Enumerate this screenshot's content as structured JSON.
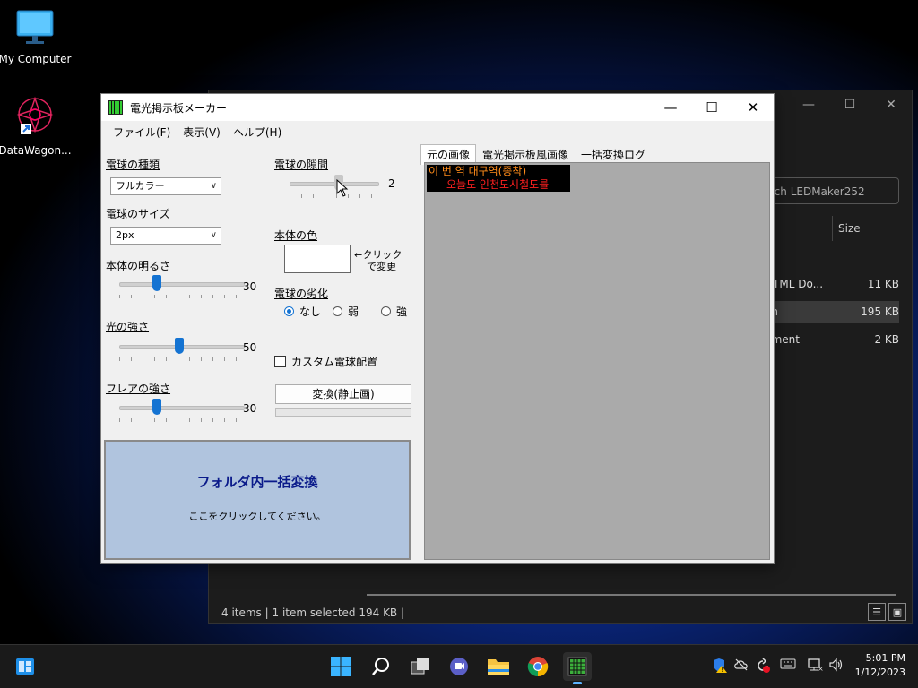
{
  "desktop": {
    "icons": [
      {
        "label": "My Computer",
        "icon": "monitor-icon"
      },
      {
        "label": "DataWagon...",
        "icon": "datawagon-shortcut-icon"
      }
    ]
  },
  "explorer": {
    "search_placeholder": "rch LEDMaker252",
    "col_size": "Size",
    "rows": [
      {
        "name": "HTML Do...",
        "size": "11 KB"
      },
      {
        "name": "on",
        "size": "195 KB",
        "selected": true
      },
      {
        "name": "ument",
        "size": "2 KB"
      }
    ],
    "status": {
      "items": "4 items",
      "selected": "1 item selected  194 KB"
    }
  },
  "app": {
    "title": "電光掲示板メーカー",
    "menu": [
      "ファイル(F)",
      "表示(V)",
      "ヘルプ(H)"
    ],
    "bulb_type": {
      "label": "電球の種類",
      "value": "フルカラー"
    },
    "bulb_size": {
      "label": "電球のサイズ",
      "value": "2px"
    },
    "body_brightness": {
      "label": "本体の明るさ",
      "value": "30"
    },
    "light_strength": {
      "label": "光の強さ",
      "value": "50"
    },
    "flare_strength": {
      "label": "フレアの強さ",
      "value": "30"
    },
    "bulb_gap": {
      "label": "電球の隙間",
      "value": "2"
    },
    "body_color": {
      "label": "本体の色",
      "hint1": "←クリック",
      "hint2": "で変更",
      "color": "#ffffff"
    },
    "bulb_degrade": {
      "label": "電球の劣化",
      "options": [
        "なし",
        "弱",
        "強"
      ],
      "selected": "なし"
    },
    "custom_layout": {
      "label": "カスタム電球配置",
      "checked": false
    },
    "convert_button": "変換(静止画)",
    "batch": {
      "title": "フォルダ内一括変換",
      "subtitle": "ここをクリックしてください。"
    },
    "tabs": [
      "元の画像",
      "電光掲示板風画像",
      "一括変換ログ"
    ],
    "active_tab": "元の画像",
    "preview": {
      "line1": "이 번 역 대구역(종착)",
      "line2": "오늘도 인천도시철도를"
    }
  },
  "taskbar": {
    "clock_time": "5:01 PM",
    "clock_date": "1/12/2023",
    "apps": [
      "windows-start-icon",
      "search-icon",
      "task-view-icon",
      "chat-icon",
      "file-explorer-icon",
      "chrome-icon",
      "led-maker-icon"
    ]
  },
  "colors": {
    "accent": "#1473d2",
    "batch_bg": "#b0c4de",
    "preview_bg": "#aaaaaa"
  }
}
